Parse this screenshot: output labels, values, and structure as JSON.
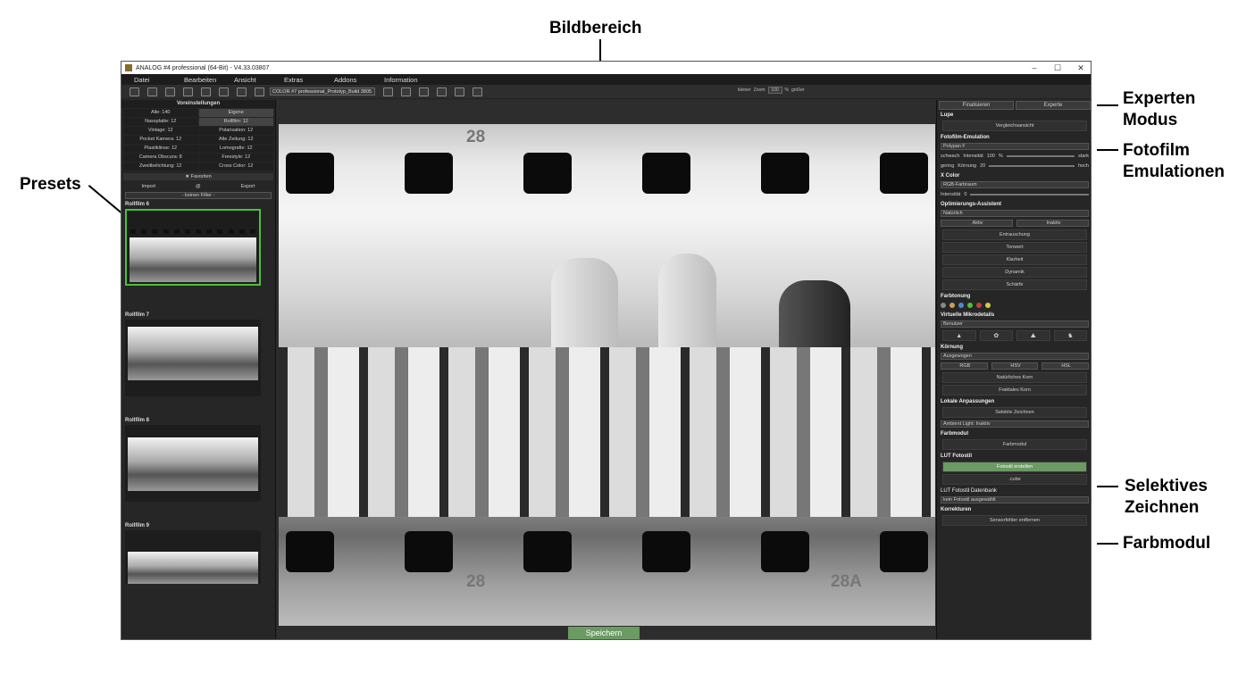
{
  "annotations": {
    "bildbereich": "Bildbereich",
    "experten_1": "Experten",
    "experten_2": "Modus",
    "fotofilm_1": "Fotofilm",
    "fotofilm_2": "Emulationen",
    "presets": "Presets",
    "selektiv_1": "Selektives",
    "selektiv_2": "Zeichnen",
    "farbmodul": "Farbmodul"
  },
  "window": {
    "title": "ANALOG #4 professional (64-Bit) - V4.33.03807",
    "min": "–",
    "max": "☐",
    "close": "✕"
  },
  "menu": [
    "Datei",
    "Bearbeiten",
    "Ansicht",
    "Extras",
    "Addons",
    "Information"
  ],
  "toolbar": {
    "preset_select": "COLOR #7 professional_Prototyp_Build 3805",
    "zoom_label": "Zoom",
    "zoom_value": "100",
    "zoom_unit": "%",
    "kleiner": "kleiner",
    "groesser": "größer"
  },
  "left": {
    "header": "Voreinstellungen",
    "all": "Alle: 140",
    "own": "Eigene",
    "cats": [
      "Nassplatte: 12",
      "Rollfilm: 12",
      "Vintage: 12",
      "Polarisation: 12",
      "Pocket Kamera: 12",
      "Alte Zeitung: 12",
      "Plastiklinse: 12",
      "Lomografie: 12",
      "Camera Obscura: 8",
      "Freestyle: 12",
      "Zweitbelichtung: 12",
      "Cross Color: 12"
    ],
    "favorites": "★ Favoriten",
    "import": "Import",
    "export": "Export",
    "filter": "- keinen Filter -",
    "presets": [
      "Rollfilm 6",
      "Rollfilm 7",
      "Rollfilm 8",
      "Rollfilm 9"
    ]
  },
  "center": {
    "frame_top": "28",
    "frame_bottom_left": "28",
    "frame_bottom_right": "28A",
    "save": "Speichern"
  },
  "right": {
    "tab_finalize": "Finalisieren",
    "tab_expert": "Experte",
    "lupe": "Lupe",
    "vergleich": "Vergleichsansicht",
    "fotofilm": "Fotofilm-Emulation",
    "film_select": "Polypan F",
    "schwach": "schwach",
    "stark": "stark",
    "intensitaet": "Intensität",
    "int_val": "100",
    "pct": "%",
    "gering": "gering",
    "hoch": "hoch",
    "koernung_lbl": "Körnung",
    "koern_val": "20",
    "xcolor": "X Color",
    "xcolor_select": "RGB-Farbraum",
    "xcolor_val": "0",
    "opt": "Optimierungs-Assistent",
    "opt_select": "Natürlich",
    "aktiv": "Aktiv",
    "inaktiv": "Inaktiv",
    "opt_items": [
      "Entrauschung",
      "Tonwert",
      "Klarheit",
      "Dynamik",
      "Schärfe"
    ],
    "farbtonung": "Farbtonung",
    "mikro": "Virtuelle Mikrodetails",
    "mikro_select": "Benutzer",
    "koernung": "Körnung",
    "koernung_select": "Ausgewogen",
    "rgb": "RGB",
    "hsv": "HSV",
    "hsl": "HSL",
    "natkorn": "Natürliches Korn",
    "fraktkorn": "Fraktales Korn",
    "lokale": "Lokale Anpassungen",
    "selektiv": "Selektiv Zeichnen",
    "ambient": "Ambient Light: Inaktiv",
    "farbmodul_sec": "Farbmodul",
    "farbmodul_btn": "Farbmodul",
    "lut": "LUT Fotostil",
    "fotostil_btn": "Fotostil erstellen",
    "cube": ".cube",
    "lut_db": "LUT Fotostil Datenbank",
    "lut_select": "kein Fotostil ausgewählt",
    "korrekturen": "Korrekturen",
    "sensor": "Sensorfehler entfernen"
  },
  "colors": {
    "accent_green": "#6b9a63",
    "active_border": "#4cc13a",
    "panel": "#262626"
  }
}
